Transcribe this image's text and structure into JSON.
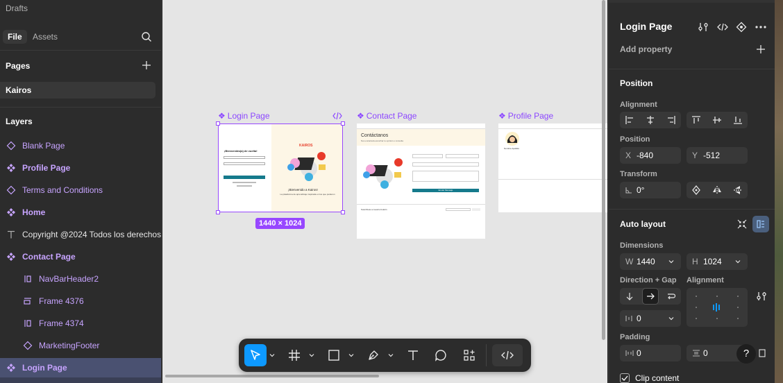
{
  "left_panel": {
    "drafts": "Drafts",
    "tabs": [
      {
        "label": "File"
      },
      {
        "label": "Assets"
      }
    ],
    "pages_title": "Pages",
    "current_page": "Kairos",
    "layers_title": "Layers",
    "layers": [
      {
        "label": "Blank Page"
      },
      {
        "label": "Profile Page"
      },
      {
        "label": "Terms and Conditions"
      },
      {
        "label": "Home"
      },
      {
        "label": "Copyright @2024 Todos los derechos"
      },
      {
        "label": "Contact Page"
      },
      {
        "label": "NavBarHeader2"
      },
      {
        "label": "Frame 4376"
      },
      {
        "label": "Frame 4374"
      },
      {
        "label": "MarketingFooter"
      },
      {
        "label": "Login Page"
      }
    ]
  },
  "canvas": {
    "frames": [
      {
        "title": "Login Page"
      },
      {
        "title": "Contact Page"
      },
      {
        "title": "Profile Page"
      }
    ],
    "selection_dims": "1440 × 1024",
    "login_thumb": {
      "heading": "¡Bienvenido(a) de vuelta!",
      "brand": "KAIROS",
      "welcome": "¡Bienvenido a Kairos!",
      "sub": "La plataforma de aprendizaje inspirada en los que pudieron"
    },
    "contact_thumb": {
      "heading": "Contáctanos",
      "sub": "Nos encantará escuchar tu opinión o consulta",
      "submit": "Enviar Mensaje",
      "suscribe": "Suscríbete a nuestro boletín"
    },
    "profile_thumb": {
      "name": "Nombre Apellido"
    }
  },
  "right_panel": {
    "title": "Login Page",
    "add_property": "Add property",
    "position_title": "Position",
    "alignment_label": "Alignment",
    "position_label": "Position",
    "x_label": "X",
    "x_value": "-840",
    "y_label": "Y",
    "y_value": "-512",
    "transform_label": "Transform",
    "rotation": "0°",
    "auto_layout_title": "Auto layout",
    "dimensions_label": "Dimensions",
    "w_label": "W",
    "w_value": "1440",
    "h_label": "H",
    "h_value": "1024",
    "direction_gap_label": "Direction + Gap",
    "al_alignment_label": "Alignment",
    "gap_value": "0",
    "padding_label": "Padding",
    "padding_h": "0",
    "padding_v": "0",
    "clip_content": "Clip content",
    "help": "?"
  }
}
